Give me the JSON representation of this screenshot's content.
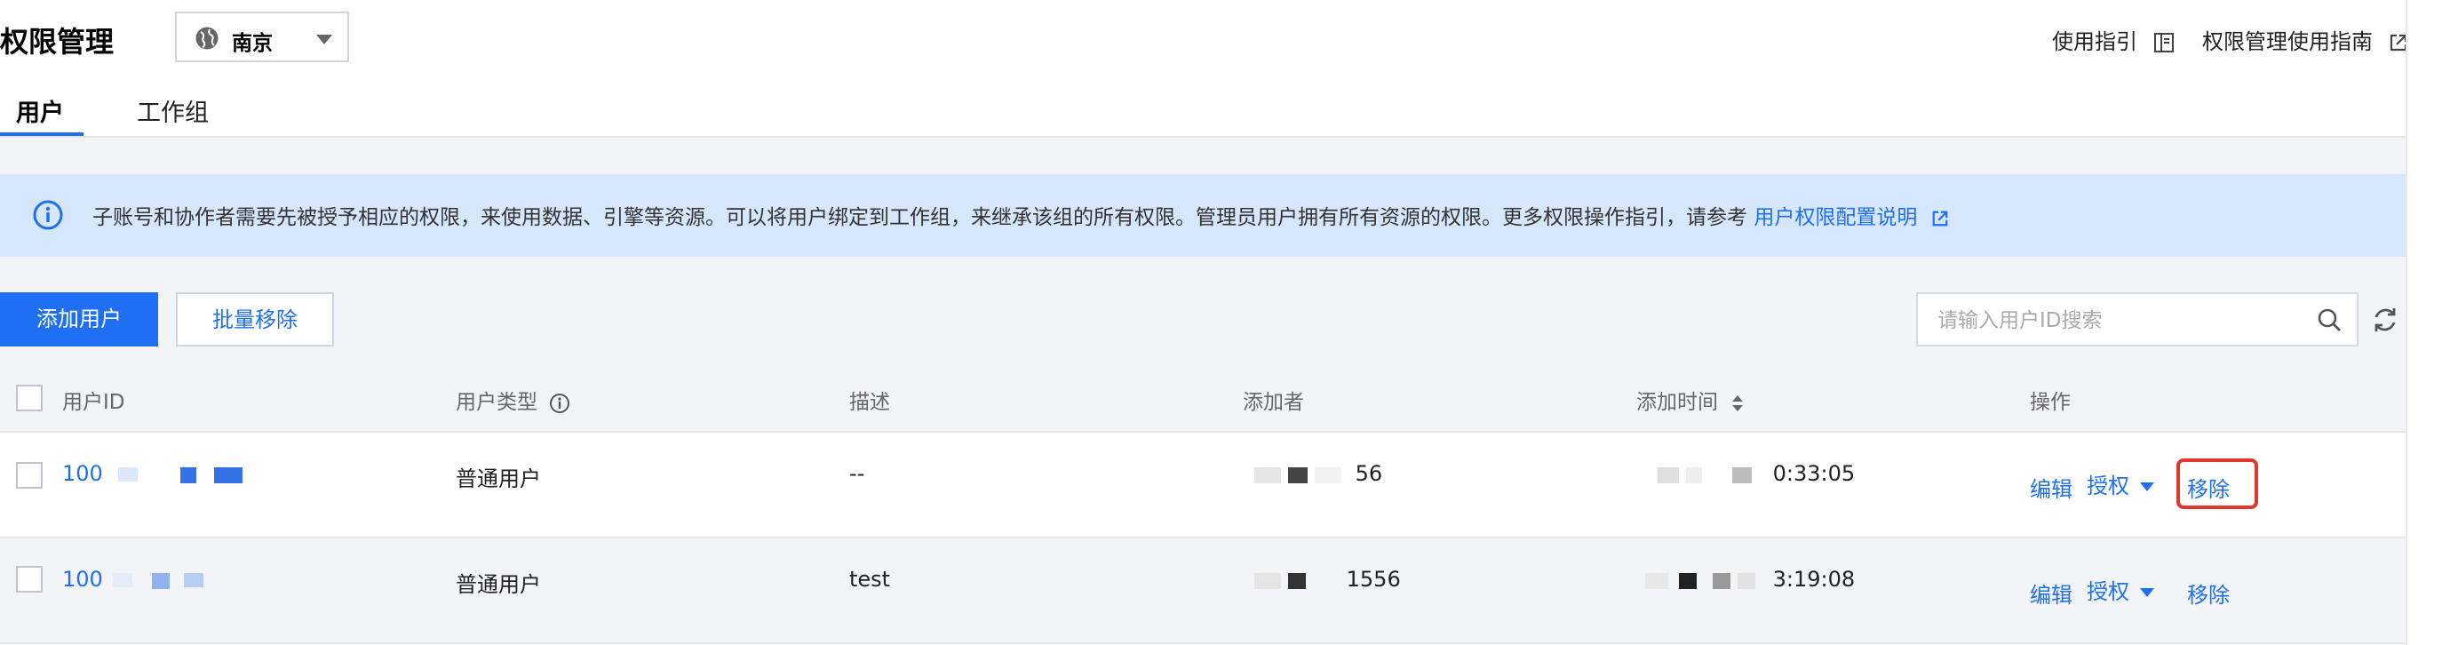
{
  "header": {
    "title": "权限管理",
    "region": "南京",
    "links": [
      {
        "label": "使用指引",
        "icon": "book-icon"
      },
      {
        "label": "权限管理使用指南",
        "icon": "external-link-icon"
      }
    ],
    "tabs": [
      {
        "label": "用户",
        "active": true
      },
      {
        "label": "工作组",
        "active": false
      }
    ]
  },
  "alert": {
    "text": "子账号和协作者需要先被授予相应的权限，来使用数据、引擎等资源。可以将用户绑定到工作组，来继承该组的所有权限。管理员用户拥有所有资源的权限。更多权限操作指引，请参考",
    "link_text": "用户权限配置说明",
    "color": "#d6e6fb"
  },
  "toolbar": {
    "add_label": "添加用户",
    "batch_remove_label": "批量移除",
    "search_placeholder": "请输入用户ID搜索"
  },
  "table": {
    "columns": [
      "用户ID",
      "用户类型",
      "描述",
      "添加者",
      "添加时间",
      "操作"
    ],
    "rows": [
      {
        "user_id": "100",
        "type": "普通用户",
        "desc": "--",
        "adder": "56",
        "time": "0:33:05",
        "actions": [
          "编辑",
          "授权",
          "移除"
        ]
      },
      {
        "user_id": "100",
        "type": "普通用户",
        "desc": "test",
        "adder": "1556",
        "time": "3:19:08",
        "actions": [
          "编辑",
          "授权",
          "移除"
        ]
      }
    ]
  },
  "colors": {
    "accent": "#1f6ff5",
    "highlight": "#e0362c"
  }
}
